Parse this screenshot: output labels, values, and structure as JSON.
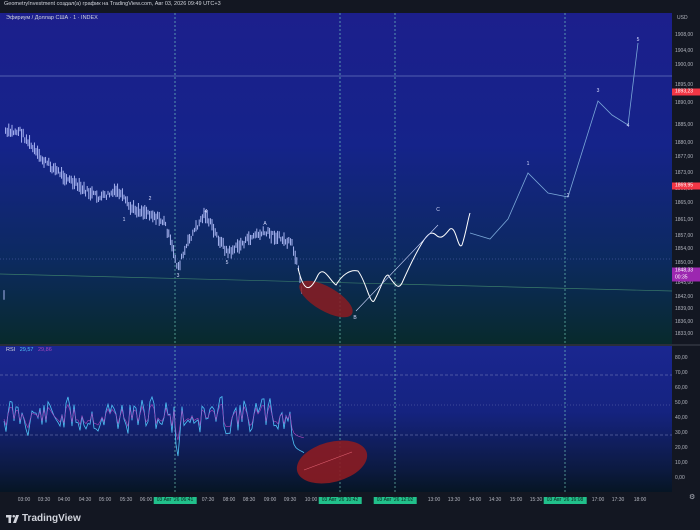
{
  "caption": "GeometryInvestment создал(а) график на TradingView.com, Авг 03, 2026 09:49 UTC+3",
  "symbol_title": "Эфириум / Доллар США · 1 · INDEX",
  "currency": "USD",
  "price_axis": {
    "ticks": [
      "1908,00",
      "1904,00",
      "1900,00",
      "1895,00",
      "1890,00",
      "1885,00",
      "1880,00",
      "1877,00",
      "1873,00",
      "1869,00",
      "1865,00",
      "1861,00",
      "1857,00",
      "1854,00",
      "1850,00",
      "1845,00",
      "1842,00",
      "1839,00",
      "1836,00",
      "1833,00"
    ],
    "tags": [
      {
        "label": "1893,23",
        "color": "#f23645",
        "kind": "red"
      },
      {
        "label": "1869,95",
        "color": "#f23645",
        "kind": "red2"
      },
      {
        "label": "1848,33",
        "color": "#9c27b0",
        "kind": "current"
      },
      {
        "label": "00:35",
        "color": "#9c27b0",
        "kind": "countdown"
      }
    ]
  },
  "rsi": {
    "title": "RSI",
    "value_1": "29,57",
    "value_2": "29,86",
    "ticks": [
      "80,00",
      "70,00",
      "60,00",
      "50,00",
      "40,00",
      "30,00",
      "20,00",
      "10,00",
      "0,00"
    ]
  },
  "time_axis": {
    "labels": [
      "03:00",
      "03:30",
      "04:00",
      "04:30",
      "05:00",
      "05:30",
      "06:00",
      "07:30",
      "08:00",
      "08:30",
      "09:00",
      "09:30",
      "10:00",
      "11:00",
      "13:00",
      "13:30",
      "14:00",
      "14:30",
      "15:00",
      "15:30",
      "17:00",
      "17:30",
      "18:00"
    ],
    "badges": [
      "03 Авг '26  06:41",
      "03 Авг '26  10:42",
      "03 Авг '26  12:02",
      "03 Авг '26  16:08"
    ]
  },
  "wave_labels": [
    "1",
    "2",
    "3",
    "4",
    "5",
    "A",
    "B",
    "C",
    "1",
    "2",
    "3",
    "4",
    "5",
    "B"
  ],
  "footer": {
    "brand": "TradingView"
  },
  "colors": {
    "accent_red": "#f23645",
    "accent_purple": "#9c27b0",
    "badge_green": "#21c08b",
    "rsi_line": "#4fc3f7",
    "candle": "#b7c3ff"
  }
}
